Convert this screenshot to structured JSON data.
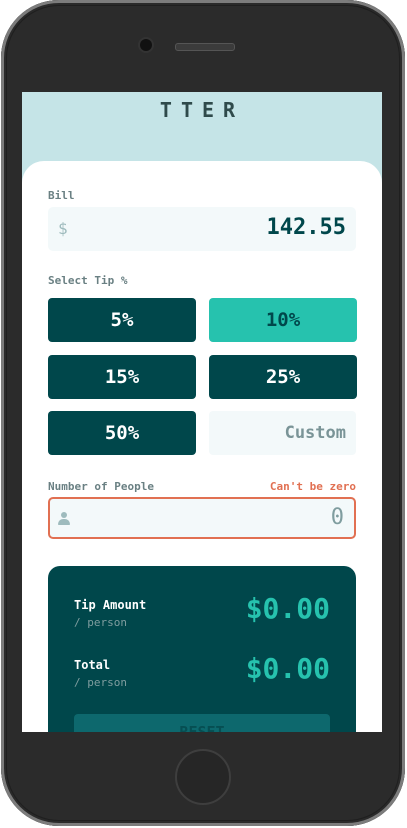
{
  "app": {
    "logo_text": "TTER"
  },
  "bill": {
    "label": "Bill",
    "currency_symbol": "$",
    "value": "142.55"
  },
  "tip": {
    "label": "Select Tip %",
    "options": [
      "5%",
      "10%",
      "15%",
      "25%",
      "50%"
    ],
    "selected": "10%",
    "custom_placeholder": "Custom"
  },
  "people": {
    "label": "Number of People",
    "error": "Can't be zero",
    "value": "0"
  },
  "results": {
    "tip_title": "Tip Amount",
    "tip_sub": "/ person",
    "tip_value": "$0.00",
    "total_title": "Total",
    "total_sub": "/ person",
    "total_value": "$0.00",
    "reset_label": "RESET"
  },
  "colors": {
    "accent": "#26c2ae",
    "dark": "#00474b",
    "error": "#e17052",
    "bg": "#c5e4e7"
  },
  "icons": {
    "person": "person-icon"
  }
}
